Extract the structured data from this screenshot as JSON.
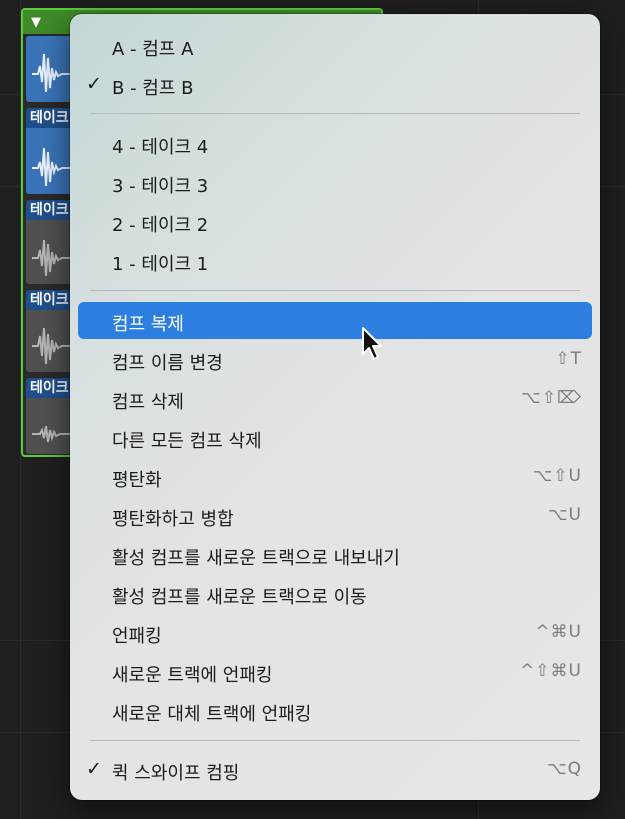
{
  "take_folder": {
    "take_labels": [
      "테이크",
      "테이크",
      "테이크",
      "테이크"
    ]
  },
  "menu": {
    "comps": [
      {
        "label": "A - 컴프 A",
        "checked": false
      },
      {
        "label": "B - 컴프 B",
        "checked": true
      }
    ],
    "takes": [
      {
        "label": "4 - 테이크 4"
      },
      {
        "label": "3 - 테이크 3"
      },
      {
        "label": "2 - 테이크 2"
      },
      {
        "label": "1 - 테이크 1"
      }
    ],
    "actions": [
      {
        "label": "컴프 복제",
        "shortcut": "",
        "highlighted": true
      },
      {
        "label": "컴프 이름 변경",
        "shortcut": "⇧T"
      },
      {
        "label": "컴프 삭제",
        "shortcut": "⌥⇧⌦"
      },
      {
        "label": "다른 모든 컴프 삭제",
        "shortcut": ""
      },
      {
        "label": "평탄화",
        "shortcut": "⌥⇧U"
      },
      {
        "label": "평탄화하고 병합",
        "shortcut": "⌥U"
      },
      {
        "label": "활성 컴프를 새로운 트랙으로 내보내기",
        "shortcut": ""
      },
      {
        "label": "활성 컴프를 새로운 트랙으로 이동",
        "shortcut": ""
      },
      {
        "label": "언패킹",
        "shortcut": "^⌘U"
      },
      {
        "label": "새로운 트랙에 언패킹",
        "shortcut": "^⇧⌘U"
      },
      {
        "label": "새로운 대체 트랙에 언패킹",
        "shortcut": ""
      }
    ],
    "quick_swipe": {
      "label": "퀵 스와이프 컴핑",
      "checked": true,
      "shortcut": "⌥Q"
    },
    "check_glyph": "✓"
  },
  "colors": {
    "highlight": "#2c7fe0",
    "folder_border": "#5ccc3a",
    "active_take": "#3a74b8"
  }
}
